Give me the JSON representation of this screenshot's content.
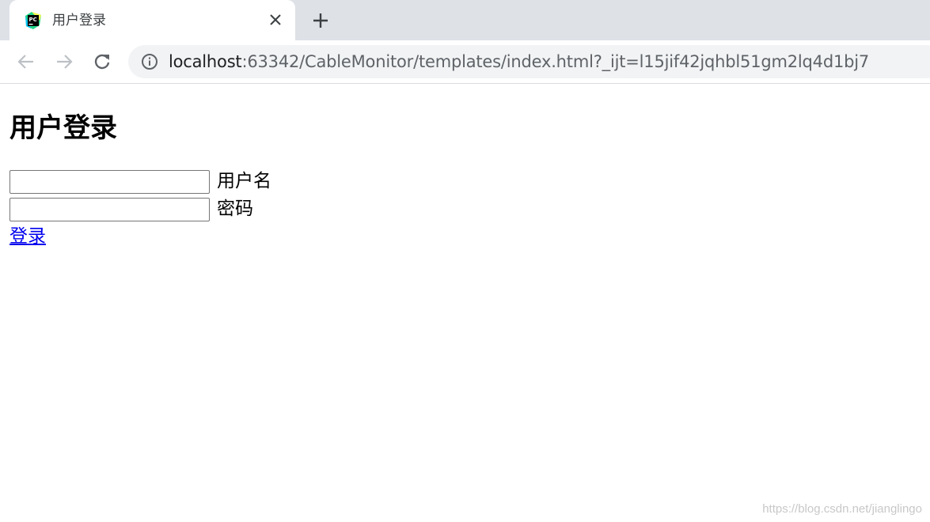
{
  "tab": {
    "title": "用户登录",
    "favicon": "pycharm-icon",
    "close_icon": "close-icon",
    "new_tab_icon": "plus-icon"
  },
  "toolbar": {
    "back_icon": "arrow-left-icon",
    "forward_icon": "arrow-right-icon",
    "reload_icon": "reload-icon",
    "info_icon": "info-icon",
    "url_host": "localhost",
    "url_rest": ":63342/CableMonitor/templates/index.html?_ijt=l15jif42jqhbl51gm2lq4d1bj7"
  },
  "page": {
    "heading": "用户登录",
    "username_label": "用户名",
    "username_value": "",
    "password_label": "密码",
    "password_value": "",
    "login_link": "登录"
  },
  "watermark": "https://blog.csdn.net/jianglingo",
  "colors": {
    "tabstrip_bg": "#dee1e6",
    "omnibox_bg": "#f1f3f4",
    "link": "#0000ee"
  }
}
